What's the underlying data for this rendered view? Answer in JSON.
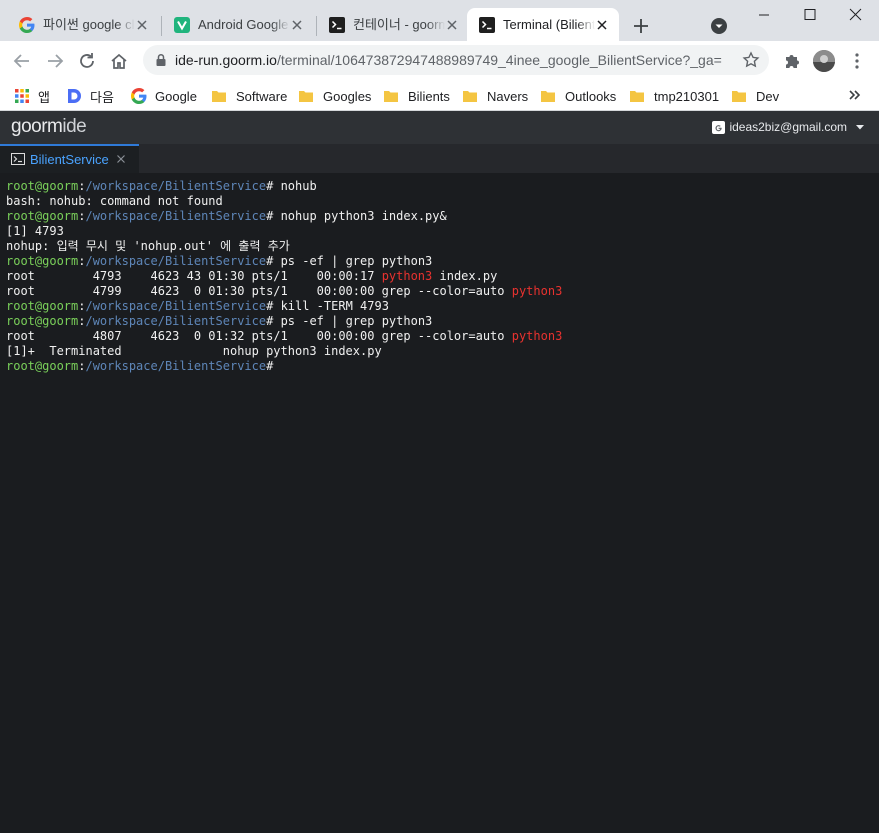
{
  "browser": {
    "tabs": [
      {
        "title": "파이썬 google cloud",
        "icon": "google-g-icon"
      },
      {
        "title": "Android Google Play",
        "icon": "vlog-v-icon"
      },
      {
        "title": "컨테이너 - goorm",
        "icon": "terminal-icon"
      },
      {
        "title": "Terminal (BilientService)",
        "icon": "terminal-icon",
        "active": true
      }
    ],
    "url_host": "ide-run.goorm.io",
    "url_path": "/terminal/106473872947488989749_4inee_google_BilientService?_ga=",
    "bookmarks": [
      {
        "label": "앱",
        "icon": "apps-grid-icon"
      },
      {
        "label": "다음",
        "icon": "daum-icon"
      },
      {
        "label": "Google",
        "icon": "google-g-icon"
      },
      {
        "label": "Software",
        "icon": "folder-icon"
      },
      {
        "label": "Googles",
        "icon": "folder-icon"
      },
      {
        "label": "Bilients",
        "icon": "folder-icon"
      },
      {
        "label": "Navers",
        "icon": "folder-icon"
      },
      {
        "label": "Outlooks",
        "icon": "folder-icon"
      },
      {
        "label": "tmp210301",
        "icon": "folder-icon"
      },
      {
        "label": "Dev",
        "icon": "folder-icon"
      }
    ]
  },
  "ide": {
    "logo": {
      "main": "goorm",
      "suffix": "ide"
    },
    "account_email": "ideas2biz@gmail.com",
    "tab_name": "BilientService"
  },
  "terminal": {
    "prompt_user": "root@goorm",
    "prompt_sep": ":",
    "prompt_path": "/workspace/BilientService",
    "prompt_symbol": "# ",
    "lines": [
      {
        "kind": "prompt",
        "cmd": "nohub"
      },
      {
        "kind": "out",
        "segs": [
          {
            "t": "bash: nohub: command not found"
          }
        ]
      },
      {
        "kind": "prompt",
        "cmd": "nohup python3 index.py&"
      },
      {
        "kind": "out",
        "segs": [
          {
            "t": "[1] 4793"
          }
        ]
      },
      {
        "kind": "out",
        "segs": [
          {
            "t": "nohup: 입력 무시 및 'nohup.out' 에 출력 추가"
          }
        ]
      },
      {
        "kind": "prompt",
        "cmd": "ps -ef | grep python3"
      },
      {
        "kind": "out",
        "segs": [
          {
            "t": "root        4793    4623 43 01:30 pts/1    00:00:17 "
          },
          {
            "t": "python3",
            "hl": true
          },
          {
            "t": " index.py"
          }
        ]
      },
      {
        "kind": "out",
        "segs": [
          {
            "t": "root        4799    4623  0 01:30 pts/1    00:00:00 grep --color=auto "
          },
          {
            "t": "python3",
            "hl": true
          }
        ]
      },
      {
        "kind": "prompt",
        "cmd": "kill -TERM 4793"
      },
      {
        "kind": "prompt",
        "cmd": "ps -ef | grep python3"
      },
      {
        "kind": "out",
        "segs": [
          {
            "t": "root        4807    4623  0 01:32 pts/1    00:00:00 grep --color=auto "
          },
          {
            "t": "python3",
            "hl": true
          }
        ]
      },
      {
        "kind": "out",
        "segs": [
          {
            "t": "[1]+  Terminated              nohup python3 index.py"
          }
        ]
      },
      {
        "kind": "prompt",
        "cmd": ""
      }
    ]
  },
  "colors": {
    "prompt_user": "#7ad05a",
    "prompt_path": "#5e86b8",
    "grep_highlight": "#e8322f",
    "terminal_bg": "#1a1c1f",
    "ide_accent": "#4aa3ff"
  }
}
